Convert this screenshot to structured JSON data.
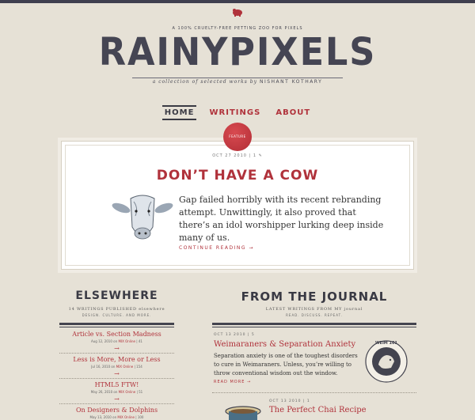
{
  "header": {
    "tagline": "A 100% CRUELTY-FREE PETTING ZOO FOR PIXELS",
    "logo": "RAINYPIXELS",
    "byline_prefix": "a collection of selected works by",
    "byline_name": "NISHANT KOTHARY"
  },
  "nav": [
    {
      "label": "HOME",
      "active": true
    },
    {
      "label": "WRITINGS",
      "active": false
    },
    {
      "label": "ABOUT",
      "active": false
    }
  ],
  "featured": {
    "seal_label": "FEATURE",
    "meta": "OCT 27 2010 | 1 ✎",
    "title": "DON’T HAVE A COW",
    "body": "Gap failed horribly with its recent rebranding attempt. Unwittingly, it also proved that there’s an idol worshipper lurking deep inside many of us.",
    "continue": "CONTINUE READING →"
  },
  "elsewhere": {
    "heading": "ELSEWHERE",
    "sub1": "14 WRITINGS PUBLISHED elsewhere",
    "sub2": "DESIGN. CULTURE. AND MORE.",
    "items": [
      {
        "title": "Article vs. Section Madness",
        "date": "Aug 12, 2010 on",
        "source": "MIX Online",
        "count": "| 41",
        "arrow": "→"
      },
      {
        "title": "Less is More, More or Less",
        "date": "Jul 16, 2010 on",
        "source": "MIX Online",
        "count": "| 154",
        "arrow": "→"
      },
      {
        "title": "HTML5 FTW!",
        "date": "May 26, 2010 on",
        "source": "MIX Online",
        "count": "| 51",
        "arrow": "→"
      },
      {
        "title": "On Designers & Dolphins",
        "date": "May 13, 2010 on",
        "source": "MIX Online",
        "count": "| 100",
        "arrow": "→"
      }
    ]
  },
  "journal": {
    "heading": "FROM THE JOURNAL",
    "sub1": "LATEST WRITINGS FROM MY journal",
    "sub2": "READ. DISCUSS. REPEAT.",
    "posts": [
      {
        "meta": "OCT 13 2010 | 5",
        "title": "Weimaraners & Separation Anxiety",
        "body": "Separation anxiety is one of the toughest disorders to cure in Weimaraners. Unless, you’re willing to throw conventional wisdom out the window.",
        "more": "READ MORE →",
        "badge": "WEIM 101"
      },
      {
        "meta": "OCT 13 2010 | 1",
        "title": "The Perfect Chai Recipe"
      }
    ]
  }
}
